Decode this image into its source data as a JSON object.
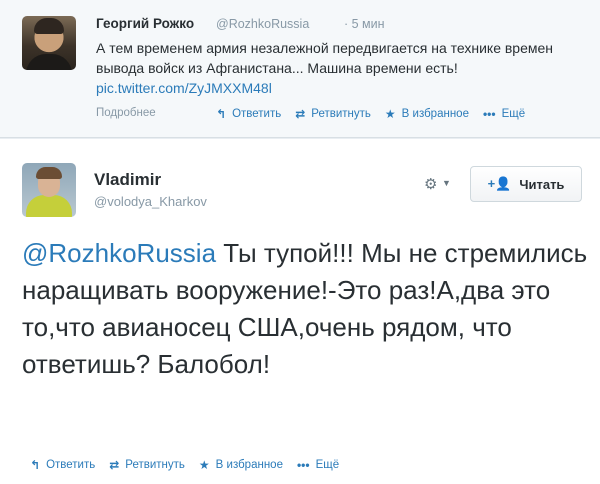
{
  "parent_tweet": {
    "author_name": "Георгий Рожко",
    "handle": "@RozhkoRussia",
    "time": "· 5 мин",
    "text": "А тем временем армия незалежной передвигается на технике времен вывода войск из Афганистана... Машина времени есть!",
    "link": "pic.twitter.com/ZyJMXXM48l",
    "details_label": "Подробнее",
    "actions": {
      "reply": "Ответить",
      "retweet": "Ретвитнуть",
      "favorite": "В избранное",
      "more": "Ещё"
    }
  },
  "main_tweet": {
    "author_name": "Vladimir",
    "handle": "@volodya_Kharkov",
    "follow_button": "Читать",
    "mention": "@RozhkoRussia",
    "text": " Ты тупой!!! Мы не стремились наращивать вооружение!-Это раз!А,два это то,что авианосец США,очень рядом, что ответишь? Балобол!",
    "actions": {
      "reply": "Ответить",
      "retweet": "Ретвитнуть",
      "favorite": "В избранное",
      "more": "Ещё"
    }
  },
  "icons": {
    "reply": "reply-arrow-icon",
    "retweet": "retweet-icon",
    "favorite": "star-icon",
    "more": "ellipsis-icon",
    "settings": "gear-icon",
    "follow": "add-user-icon"
  },
  "colors": {
    "link": "#2b7bb9",
    "muted": "#8899a6",
    "text": "#292f33"
  }
}
